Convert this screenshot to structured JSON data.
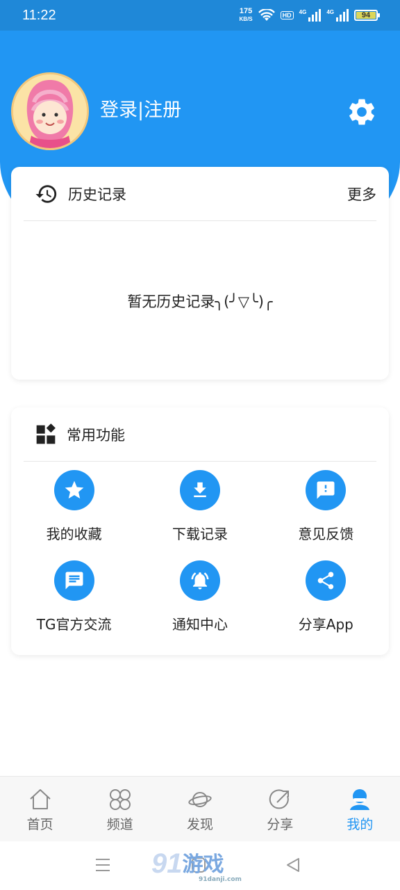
{
  "status_bar": {
    "time": "11:22",
    "speed_value": "175",
    "speed_unit": "KB/S",
    "hd": "HD",
    "net1": "4G",
    "net2": "4G",
    "battery": "94"
  },
  "profile": {
    "login_label": "登录|注册"
  },
  "history": {
    "title": "历史记录",
    "more": "更多",
    "empty": "暂无历史记录╮(╯▽╰)╭"
  },
  "functions": {
    "title": "常用功能",
    "items": [
      {
        "label": "我的收藏",
        "icon": "star-icon"
      },
      {
        "label": "下载记录",
        "icon": "download-icon"
      },
      {
        "label": "意见反馈",
        "icon": "feedback-icon"
      },
      {
        "label": "TG官方交流",
        "icon": "chat-icon"
      },
      {
        "label": "通知中心",
        "icon": "bell-icon"
      },
      {
        "label": "分享App",
        "icon": "share-icon"
      }
    ]
  },
  "bottom_nav": {
    "items": [
      {
        "label": "首页",
        "icon": "home-icon"
      },
      {
        "label": "频道",
        "icon": "channel-icon"
      },
      {
        "label": "发现",
        "icon": "planet-icon"
      },
      {
        "label": "分享",
        "icon": "share-arrow-icon"
      },
      {
        "label": "我的",
        "icon": "profile-icon",
        "active": true
      }
    ]
  },
  "watermark": {
    "logo_number": "91",
    "logo_text": "游戏",
    "url": "91danji.com"
  },
  "colors": {
    "primary": "#2196f3",
    "status_bar": "#1f88d8"
  }
}
